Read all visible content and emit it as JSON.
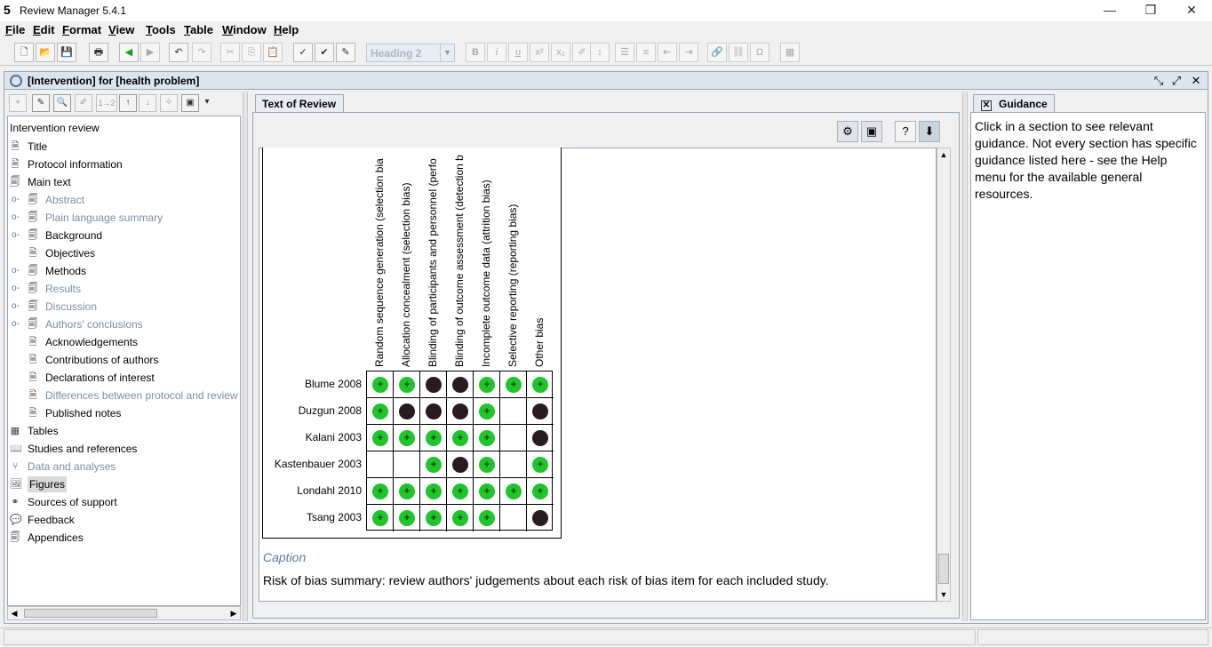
{
  "window": {
    "title": "Review Manager 5.4.1"
  },
  "menu": [
    "File",
    "Edit",
    "Format",
    "View",
    "Tools",
    "Table",
    "Window",
    "Help"
  ],
  "toolbar": {
    "style_select": "Heading 2"
  },
  "document": {
    "title": "[Intervention] for [health problem]"
  },
  "tree": {
    "root": "Intervention review",
    "items": [
      "Title",
      "Protocol information",
      "Main text",
      "Abstract",
      "Plain language summary",
      "Background",
      "Objectives",
      "Methods",
      "Results",
      "Discussion",
      "Authors' conclusions",
      "Acknowledgements",
      "Contributions of authors",
      "Declarations of interest",
      "Differences between protocol and review",
      "Published notes",
      "Tables",
      "Studies and references",
      "Data and analyses",
      "Figures",
      "Sources of support",
      "Feedback",
      "Appendices"
    ]
  },
  "center": {
    "tab": "Text of Review"
  },
  "figure": {
    "columns": [
      "Random sequence generation (selection bia",
      "Allocation concealment (selection bias)",
      "Blinding of participants and personnel (perfo",
      "Blinding of outcome assessment (detection b",
      "Incomplete outcome data (attrition bias)",
      "Selective reporting (reporting bias)",
      "Other bias"
    ],
    "studies": [
      "Blume 2008",
      "Duzgun 2008",
      "Kalani 2003",
      "Kastenbauer 2003",
      "Londahl 2010",
      "Tsang 2003"
    ],
    "judgements": [
      [
        "low",
        "low",
        "high",
        "high",
        "low",
        "low",
        "low"
      ],
      [
        "low",
        "high",
        "high",
        "high",
        "low",
        "",
        "high"
      ],
      [
        "low",
        "low",
        "low",
        "low",
        "low",
        "",
        "high"
      ],
      [
        "",
        "",
        "low",
        "high",
        "low",
        "",
        "low"
      ],
      [
        "low",
        "low",
        "low",
        "low",
        "low",
        "low",
        "low"
      ],
      [
        "low",
        "low",
        "low",
        "low",
        "low",
        "",
        "high"
      ]
    ],
    "caption_label": "Caption",
    "caption_text": "Risk of bias summary: review authors' judgements about each risk of bias item for each included study."
  },
  "guidance": {
    "tab": "Guidance",
    "text": "Click in a section to see relevant guidance. Not every section has specific guidance listed here - see the Help menu for the available general resources."
  },
  "colors": {
    "low_risk": "#22c32d",
    "high_risk": "#2a1a22",
    "caption": "#5c7ba8",
    "grey_node": "#7b8ea6"
  }
}
